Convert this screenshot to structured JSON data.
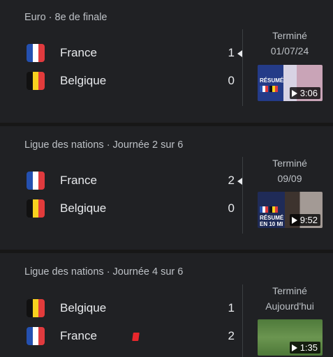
{
  "matches": [
    {
      "competition": "Euro · 8e de finale",
      "teams": [
        {
          "name": "France",
          "flag": "france-flag",
          "score": "1",
          "winner": true,
          "red_card": false
        },
        {
          "name": "Belgique",
          "flag": "belgium-flag",
          "score": "0",
          "winner": false,
          "red_card": false
        }
      ],
      "status": "Terminé",
      "date": "01/07/24",
      "video": {
        "duration": "3:06",
        "label": "RÉSUMÉ"
      }
    },
    {
      "competition": "Ligue des nations · Journée 2 sur 6",
      "teams": [
        {
          "name": "France",
          "flag": "france-flag",
          "score": "2",
          "winner": true,
          "red_card": false
        },
        {
          "name": "Belgique",
          "flag": "belgium-flag",
          "score": "0",
          "winner": false,
          "red_card": false
        }
      ],
      "status": "Terminé",
      "date": "09/09",
      "video": {
        "duration": "9:52",
        "label": "RÉSUMÉ EN 10 MI"
      }
    },
    {
      "competition": "Ligue des nations · Journée 4 sur 6",
      "teams": [
        {
          "name": "Belgique",
          "flag": "belgium-flag",
          "score": "1",
          "winner": false,
          "red_card": false
        },
        {
          "name": "France",
          "flag": "france-flag",
          "score": "2",
          "winner": false,
          "red_card": true
        }
      ],
      "status": "Terminé",
      "date": "Aujourd'hui",
      "video": {
        "duration": "1:35"
      }
    }
  ],
  "colors": {
    "background": "#171717",
    "card": "#202124",
    "text": "#e8eaed",
    "secondary_text": "#bdc1c6",
    "red_card": "#e8272c"
  }
}
